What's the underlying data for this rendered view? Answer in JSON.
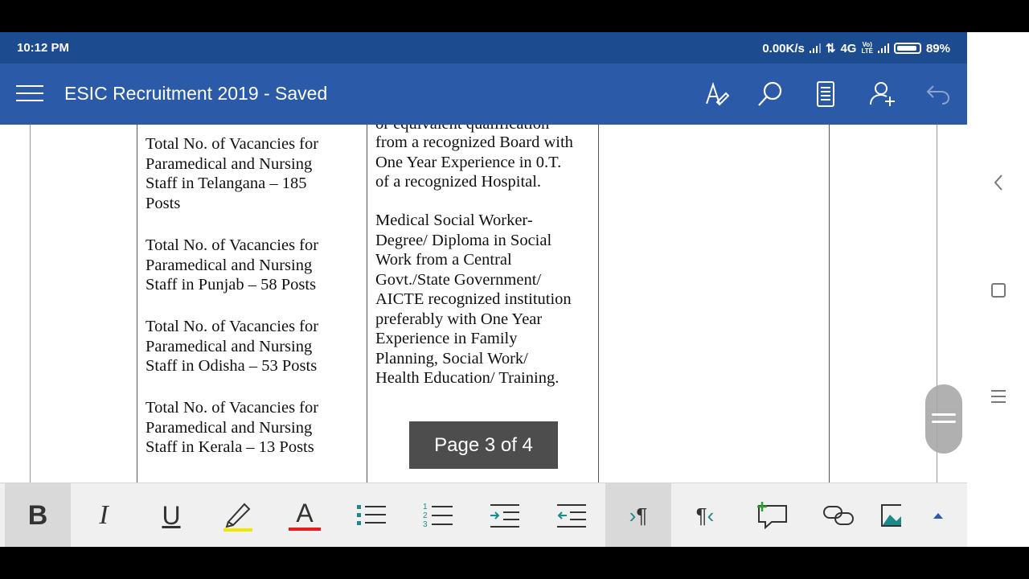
{
  "status_bar": {
    "time": "10:12 PM",
    "network_speed": "0.00K/s",
    "network_type": "4G",
    "volte_top": "Vo)",
    "volte_bottom": "LTE",
    "battery": "89%"
  },
  "app_bar": {
    "title": "ESIC Recruitment 2019 - Saved",
    "icons": [
      "menu-icon",
      "pen-icon",
      "search-icon",
      "reading-view-icon",
      "share-person-icon",
      "undo-icon"
    ]
  },
  "document": {
    "column1_blocks": [
      [
        "Total No. of Vacancies for",
        "Paramedical and Nursing",
        "Staff in Telangana – 185",
        "Posts"
      ],
      [
        "Total No. of Vacancies for",
        "Paramedical and Nursing",
        "Staff in Punjab – 58 Posts"
      ],
      [
        "Total No. of Vacancies for",
        "Paramedical and Nursing",
        "Staff in Odisha – 53 Posts"
      ],
      [
        "Total No. of Vacancies for",
        "Paramedical and Nursing",
        "Staff in Kerala – 13 Posts"
      ]
    ],
    "column2_cut_line": "or equivalent qualification",
    "column2_block1": [
      "from a recognized Board with",
      "One Year Experience in 0.T.",
      "of a recognized Hospital."
    ],
    "column2_block2": [
      "Medical Social Worker-",
      "Degree/ Diploma in Social",
      "Work from a Central",
      "Govt./State Government/",
      "AICTE recognized institution",
      "preferably with One Year",
      "Experience in Family",
      "Planning, Social Work/",
      "Health Education/ Training."
    ]
  },
  "page_indicator": "Page 3 of 4",
  "toolbar": {
    "bold": "B",
    "italic": "I",
    "underline": "U",
    "font_color_letter": "A",
    "highlight_color": "#f2e600",
    "font_color": "#e02020",
    "accent": "#1b8a8a",
    "icons": [
      "bold-icon",
      "italic-icon",
      "underline-icon",
      "highlighter-icon",
      "font-color-icon",
      "bullet-list-icon",
      "numbered-list-icon",
      "increase-indent-icon",
      "decrease-indent-icon",
      "ltr-paragraph-icon",
      "rtl-paragraph-icon",
      "new-comment-icon",
      "link-icon",
      "insert-picture-icon",
      "expand-toolbar-icon"
    ]
  },
  "colors": {
    "status_bar": "#1d4b8f",
    "app_bar": "#2b5aa8",
    "page_indicator_bg": "#4d4d4d"
  }
}
